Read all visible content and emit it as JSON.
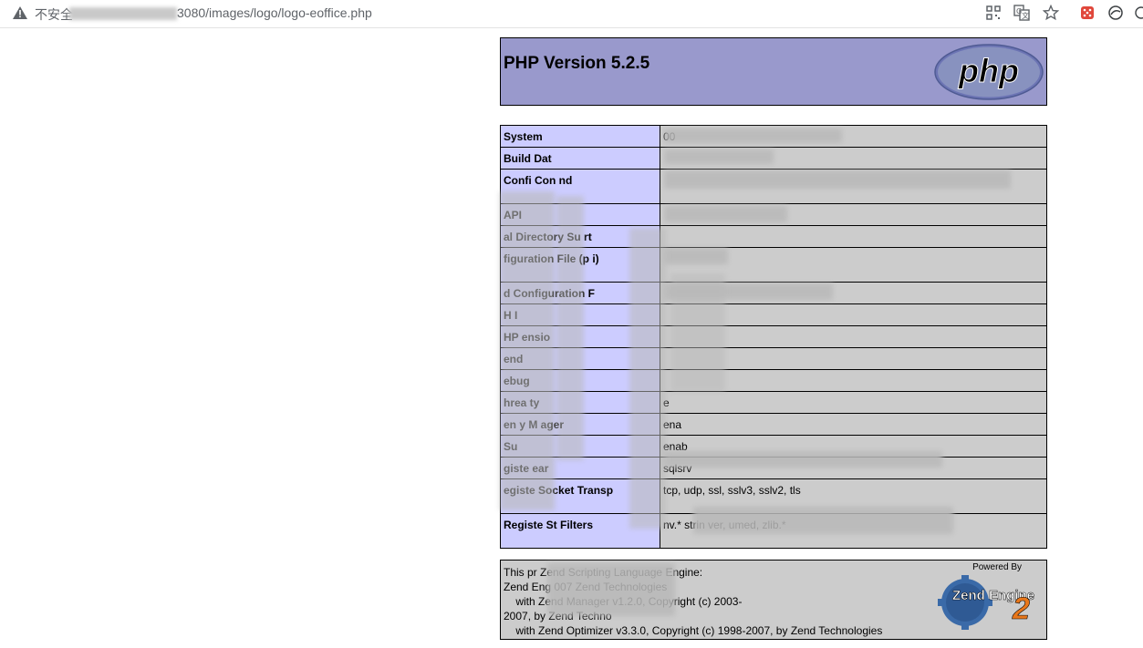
{
  "browser": {
    "security_label": "不安全",
    "url_tail": "3080/images/logo/logo-eoffice.php",
    "toolbar_icons": [
      "qr-code-icon",
      "translate-icon",
      "bookmark-star-icon",
      "extension-icon",
      "profile-icon",
      "menu-icon"
    ]
  },
  "phpinfo": {
    "title": "PHP Version 5.2.5",
    "logo_text": "php",
    "rows": [
      {
        "label": "System",
        "value": "00"
      },
      {
        "label": "Build Dat",
        "value": ""
      },
      {
        "label": "Confi Con nd",
        "value": ""
      },
      {
        "label": "API",
        "value": ""
      },
      {
        "label": "al Directory Su rt",
        "value": ""
      },
      {
        "label": "figuration File (p i)",
        "value": ""
      },
      {
        "label": "d Configuration F",
        "value": ""
      },
      {
        "label": "H I",
        "value": ""
      },
      {
        "label": "HP ensio",
        "value": ""
      },
      {
        "label": "end",
        "value": ""
      },
      {
        "label": "ebug",
        "value": ""
      },
      {
        "label": "hrea ty",
        "value": "e"
      },
      {
        "label": "en y M ager",
        "value": "ena"
      },
      {
        "label": "Su",
        "value": "enab"
      },
      {
        "label": "giste ear",
        "value": "sqlsrv"
      },
      {
        "label": "egiste Socket Transp",
        "value": "tcp, udp, ssl, sslv3, sslv2, tls"
      },
      {
        "label": "Registe St Filters",
        "value": "nv.* strin ver, umed, zlib.*"
      }
    ],
    "footer_text": "This pr Zend Scripting Language Engine:\nZend Eng 007 Zend Technologies\n    with Zend Manager v1.2.0, Copyright (c) 2003-\n2007, by Zend Techno\n    with Zend Optimizer v3.3.0, Copyright (c) 1998-2007, by Zend Technologies",
    "powered_by": "Powered By",
    "zend_logo_text": "Zend Engine",
    "zend_logo_num": "2"
  },
  "colors": {
    "header_bg": "#9999cc",
    "label_bg": "#ccccff",
    "value_bg": "#cccccc"
  }
}
